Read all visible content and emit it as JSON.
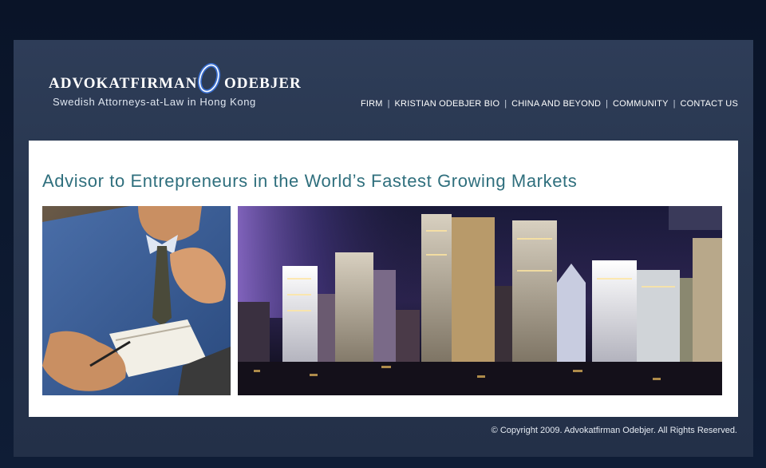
{
  "header": {
    "logo_left": "Advokatfirman",
    "logo_right": "Odebjer",
    "tagline": "Swedish Attorneys-at-Law in Hong Kong"
  },
  "nav": {
    "items": [
      {
        "label": "FIRM"
      },
      {
        "label": "KRISTIAN ODEBJER BIO"
      },
      {
        "label": "CHINA AND BEYOND"
      },
      {
        "label": "COMMUNITY"
      },
      {
        "label": "CONTACT US"
      }
    ],
    "separator": "|"
  },
  "main": {
    "headline": "Advisor to Entrepreneurs in the World’s Fastest Growing Markets"
  },
  "footer": {
    "copyright": "© Copyright 2009. Advokatfirman Odebjer. All Rights Reserved."
  },
  "colors": {
    "background": "#0c1830",
    "frame": "#2a3952",
    "headline": "#2f6f7d",
    "logo_accent": "#3a6fd0"
  },
  "icons": {
    "logo_mark": "logo-o-mark-icon"
  }
}
